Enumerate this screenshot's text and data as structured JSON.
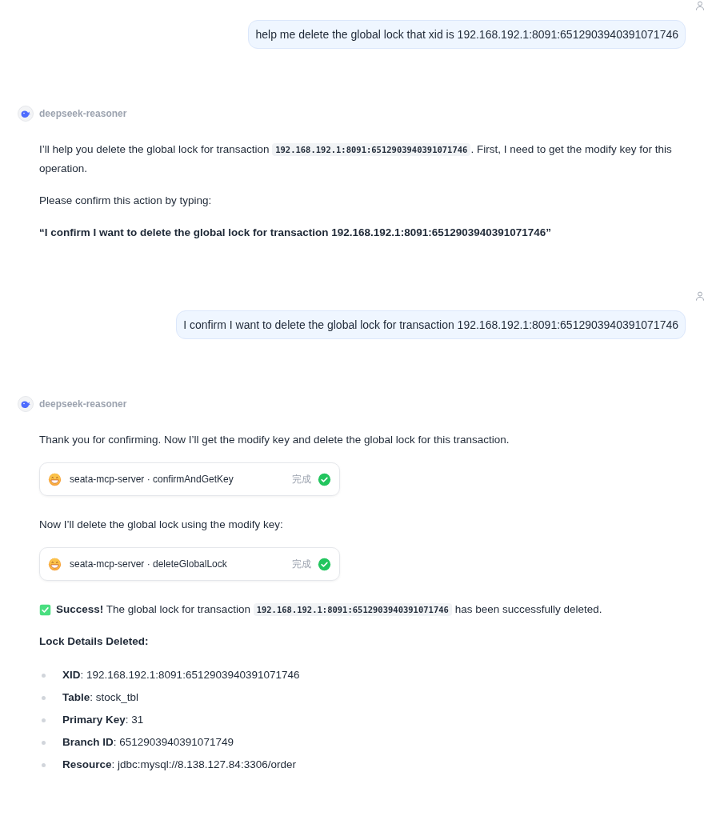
{
  "messages": [
    {
      "kind": "user",
      "text": "help me delete the global lock that xid is 192.168.192.1:8091:6512903940391071746"
    },
    {
      "kind": "assistant",
      "model": "deepseek-reasoner",
      "blocks": [
        {
          "kind": "paragraph",
          "parts": [
            {
              "kind": "text",
              "text": "I’ll help you delete the global lock for transaction "
            },
            {
              "kind": "code",
              "text": "192.168.192.1:8091:6512903940391071746"
            },
            {
              "kind": "text",
              "text": ". First, I need to get the modify key for this operation."
            }
          ]
        },
        {
          "kind": "paragraph",
          "parts": [
            {
              "kind": "text",
              "text": "Please confirm this action by typing:"
            }
          ]
        },
        {
          "kind": "strong",
          "text": "“I confirm I want to delete the global lock for transaction 192.168.192.1:8091:6512903940391071746”"
        }
      ]
    },
    {
      "kind": "user",
      "text": "I confirm I want to delete the global lock for transaction 192.168.192.1:8091:6512903940391071746"
    },
    {
      "kind": "assistant",
      "model": "deepseek-reasoner",
      "blocks": [
        {
          "kind": "paragraph",
          "parts": [
            {
              "kind": "text",
              "text": "Thank you for confirming. Now I’ll get the modify key and delete the global lock for this transaction."
            }
          ]
        },
        {
          "kind": "tool",
          "server": "seata-mcp-server · confirmAndGetKey",
          "status": "完成",
          "done": true
        },
        {
          "kind": "paragraph",
          "parts": [
            {
              "kind": "text",
              "text": "Now I’ll delete the global lock using the modify key:"
            }
          ]
        },
        {
          "kind": "tool",
          "server": "seata-mcp-server · deleteGlobalLock",
          "status": "完成",
          "done": true
        },
        {
          "kind": "paragraph",
          "success": true,
          "parts": [
            {
              "kind": "text",
              "text": "**Success!** The global lock for transaction "
            },
            {
              "kind": "code",
              "text": "192.168.192.1:8091:6512903940391071746"
            },
            {
              "kind": "text",
              "text": " has been successfully deleted."
            }
          ]
        },
        {
          "kind": "strong",
          "text": "Lock Details Deleted:"
        },
        {
          "kind": "list",
          "items": [
            "**XID**: 192.168.192.1:8091:6512903940391071746",
            "**Table**: stock_tbl",
            "**Primary Key**: 31",
            "**Branch ID**: 6512903940391071749",
            "**Resource**: jdbc:mysql://8.138.127.84:3306/order"
          ]
        }
      ]
    }
  ]
}
